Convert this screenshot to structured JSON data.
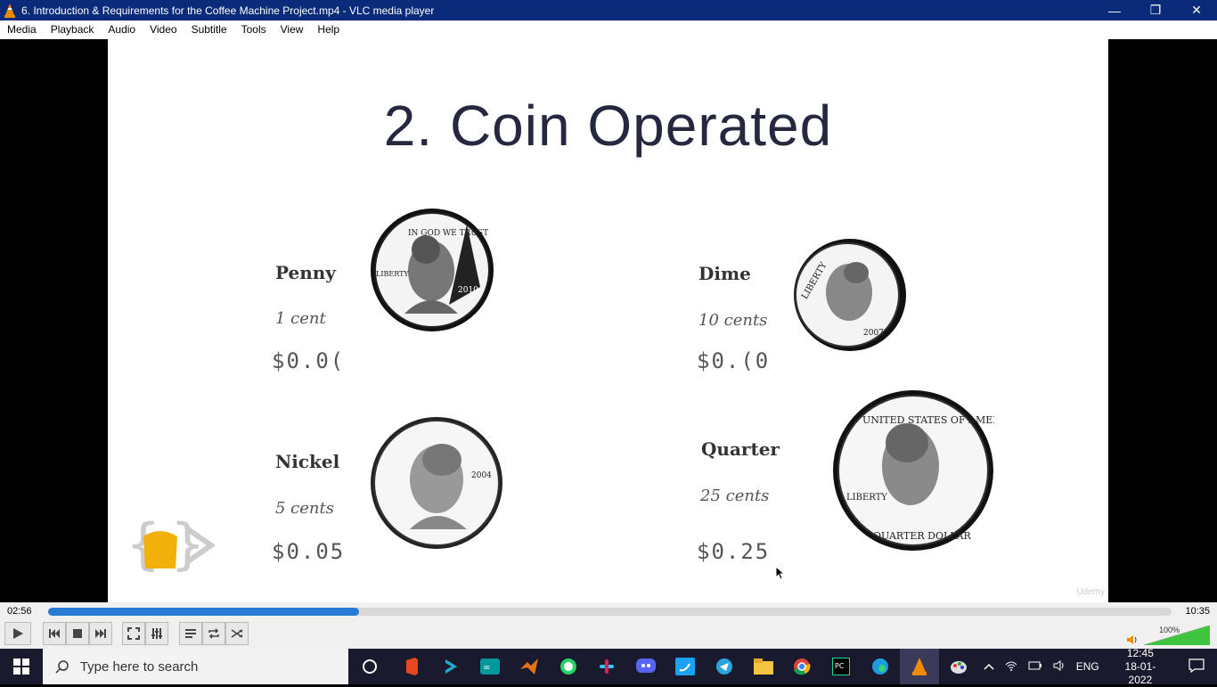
{
  "window": {
    "title": "6. Introduction & Requirements for the Coffee Machine Project.mp4 - VLC media player",
    "minimize": "—",
    "restore": "❐",
    "close": "✕"
  },
  "menu": [
    "Media",
    "Playback",
    "Audio",
    "Video",
    "Subtitle",
    "Tools",
    "View",
    "Help"
  ],
  "slide": {
    "title": "2. Coin Operated",
    "coins": [
      {
        "name": "Penny",
        "cents": "1 cent",
        "price": "$0.0("
      },
      {
        "name": "Dime",
        "cents": "10 cents",
        "price": "$0.(0"
      },
      {
        "name": "Nickel",
        "cents": "5 cents",
        "price": "$0.05"
      },
      {
        "name": "Quarter",
        "cents": "25 cents",
        "price": "$0.25"
      }
    ],
    "penny_year": "2010",
    "dime_year": "2007",
    "nickel_year": "2004",
    "motto": "IN GOD WE TRUST",
    "liberty": "LIBERTY",
    "quarter_top": "UNITED STATES OF AMERICA",
    "quarter_bottom": "QUARTER DOLLAR",
    "watermark": "Udemy"
  },
  "player": {
    "elapsed": "02:56",
    "total": "10:35",
    "progress": 0.277,
    "volume_label": "100%",
    "volume": 1.0
  },
  "taskbar": {
    "search_placeholder": "Type here to search",
    "language": "ENG",
    "time": "12:45",
    "date": "18-01-2022",
    "apps": [
      "cortana-icon",
      "office-icon",
      "kite-icon",
      "arduino-icon",
      "matlab-icon",
      "whatsapp-icon",
      "slack-icon",
      "discord-icon",
      "twitter-icon",
      "telegram-icon",
      "file-explorer-icon",
      "chrome-icon",
      "pycharm-icon",
      "edge-icon",
      "vlc-icon",
      "paint-icon"
    ]
  }
}
